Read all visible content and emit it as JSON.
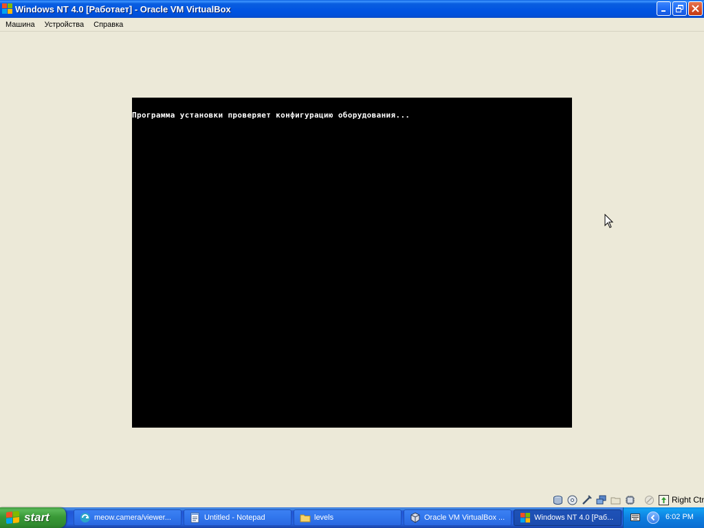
{
  "window": {
    "title": "Windows NT 4.0 [Работает] - Oracle VM VirtualBox"
  },
  "menubar": {
    "items": [
      {
        "label": "Машина"
      },
      {
        "label": "Устройства"
      },
      {
        "label": "Справка"
      }
    ]
  },
  "guest": {
    "console_text": "Программа установки проверяет конфигурацию оборудования..."
  },
  "status_bar": {
    "icons": [
      "hard-disk-icon",
      "optical-drive-icon",
      "usb-icon",
      "network-icon",
      "shared-folders-icon",
      "cpu-icon",
      "mouse-integration-icon",
      "host-key-icon"
    ],
    "host_key_label": "Right Ctrl"
  },
  "taskbar": {
    "start_label": "start",
    "tasks": [
      {
        "label": "meow.camera/viewer...",
        "icon": "browser-icon",
        "active": false
      },
      {
        "label": "Untitled - Notepad",
        "icon": "notepad-icon",
        "active": false
      },
      {
        "label": "levels",
        "icon": "folder-icon",
        "active": false
      },
      {
        "label": "Oracle VM VirtualBox ...",
        "icon": "virtualbox-icon",
        "active": false
      },
      {
        "label": "Windows NT 4.0 [Раб...",
        "icon": "windows-icon",
        "active": true
      }
    ],
    "clock": "6:02 PM"
  },
  "colors": {
    "titlebar_blue": "#0053E1",
    "window_bg": "#ECE9D8",
    "guest_bg": "#000000",
    "start_green": "#3A9A37",
    "taskbar_blue": "#2663E0",
    "tray_blue": "#0E7FE0"
  }
}
